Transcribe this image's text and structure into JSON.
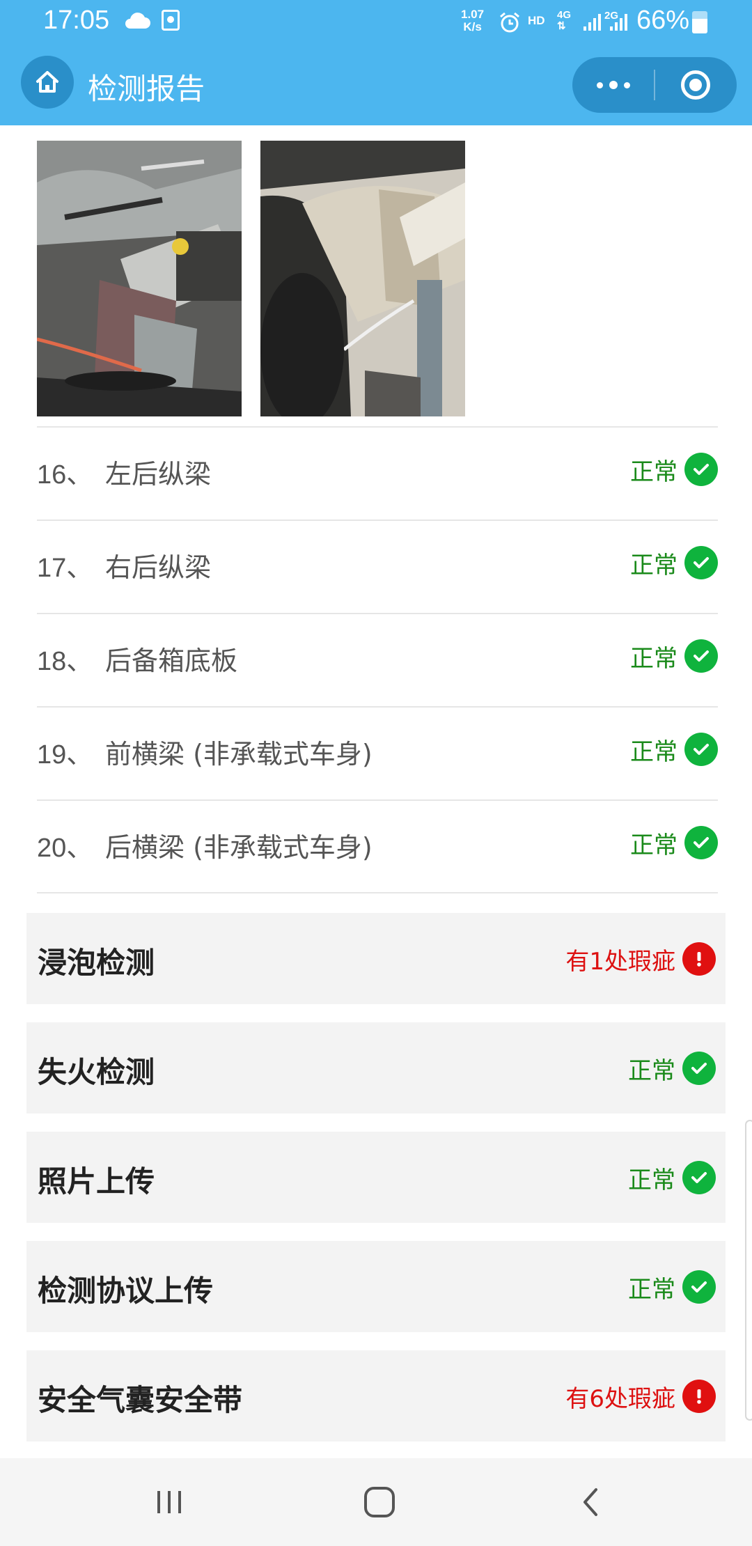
{
  "status_bar": {
    "time": "17:05",
    "speed_value": "1.07",
    "speed_unit": "K/s",
    "hd": "HD",
    "network_top": "4G",
    "network_2g": "2G",
    "battery_percent": "66%",
    "battery_level": 0.66,
    "icons": [
      "cloud-icon",
      "notification-icon",
      "alarm-icon",
      "signal-icon",
      "battery-icon"
    ]
  },
  "header": {
    "title": "检测报告",
    "background_color": "#4cb6ef",
    "icons": [
      "home-icon",
      "more-icon",
      "close-miniprogram-icon"
    ]
  },
  "items": [
    {
      "num": "16、",
      "name": "左后纵梁",
      "status": "正常"
    },
    {
      "num": "17、",
      "name": "右后纵梁",
      "status": "正常"
    },
    {
      "num": "18、",
      "name": "后备箱底板",
      "status": "正常"
    },
    {
      "num": "19、",
      "name": "前横梁 (非承载式车身)",
      "status": "正常"
    },
    {
      "num": "20、",
      "name": "后横梁 (非承载式车身)",
      "status": "正常"
    }
  ],
  "sections": [
    {
      "title": "浸泡检测",
      "status": "有1处瑕疵",
      "state": "issue"
    },
    {
      "title": "失火检测",
      "status": "正常",
      "state": "ok"
    },
    {
      "title": "照片上传",
      "status": "正常",
      "state": "ok"
    },
    {
      "title": "检测协议上传",
      "status": "正常",
      "state": "ok"
    },
    {
      "title": "安全气囊安全带",
      "status": "有6处瑕疵",
      "state": "issue"
    }
  ],
  "colors": {
    "ok": "#1a8a1a",
    "ok_badge": "#0fb33d",
    "issue": "#dd1111",
    "issue_badge": "#e01010"
  },
  "navbar": {
    "icons": [
      "recent-apps-icon",
      "home-circle-icon",
      "back-icon"
    ]
  }
}
